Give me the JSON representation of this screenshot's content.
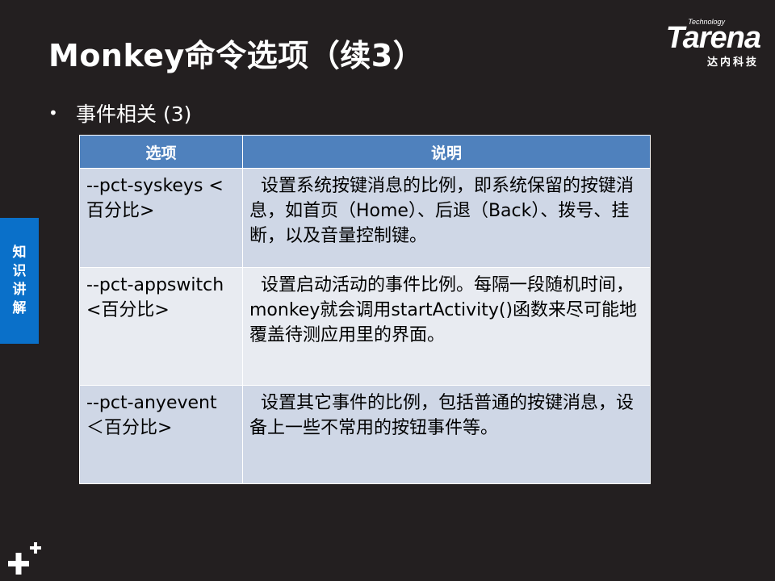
{
  "slide": {
    "title": "Monkey命令选项（续3）",
    "bullet": "事件相关 (3)"
  },
  "logo": {
    "tagline": "Technology",
    "word": "Tarena",
    "chinese": "达内科技"
  },
  "side_tab": {
    "label": "知识讲解"
  },
  "table": {
    "headers": [
      "选项",
      "说明"
    ],
    "rows": [
      {
        "option": "--pct-syskeys <百分比>",
        "description": "  设置系统按键消息的比例，即系统保留的按键消息，如首页（Home）、后退（Back）、拨号、挂断，以及音量控制键。"
      },
      {
        "option": "--pct-appswitch <百分比>",
        "description": "  设置启动活动的事件比例。每隔一段随机时间，monkey就会调用startActivity()函数来尽可能地覆盖待测应用里的界面。"
      },
      {
        "option": "--pct-anyevent ＜百分比>",
        "description": "  设置其它事件的比例，包括普通的按键消息，设备上一些不常用的按钮事件等。"
      }
    ]
  },
  "colors": {
    "background": "#231f20",
    "header_blue": "#4f81bd",
    "row_dark": "#cfd7e6",
    "row_light": "#e8ebf1",
    "side_tab_blue": "#0a70c9"
  }
}
